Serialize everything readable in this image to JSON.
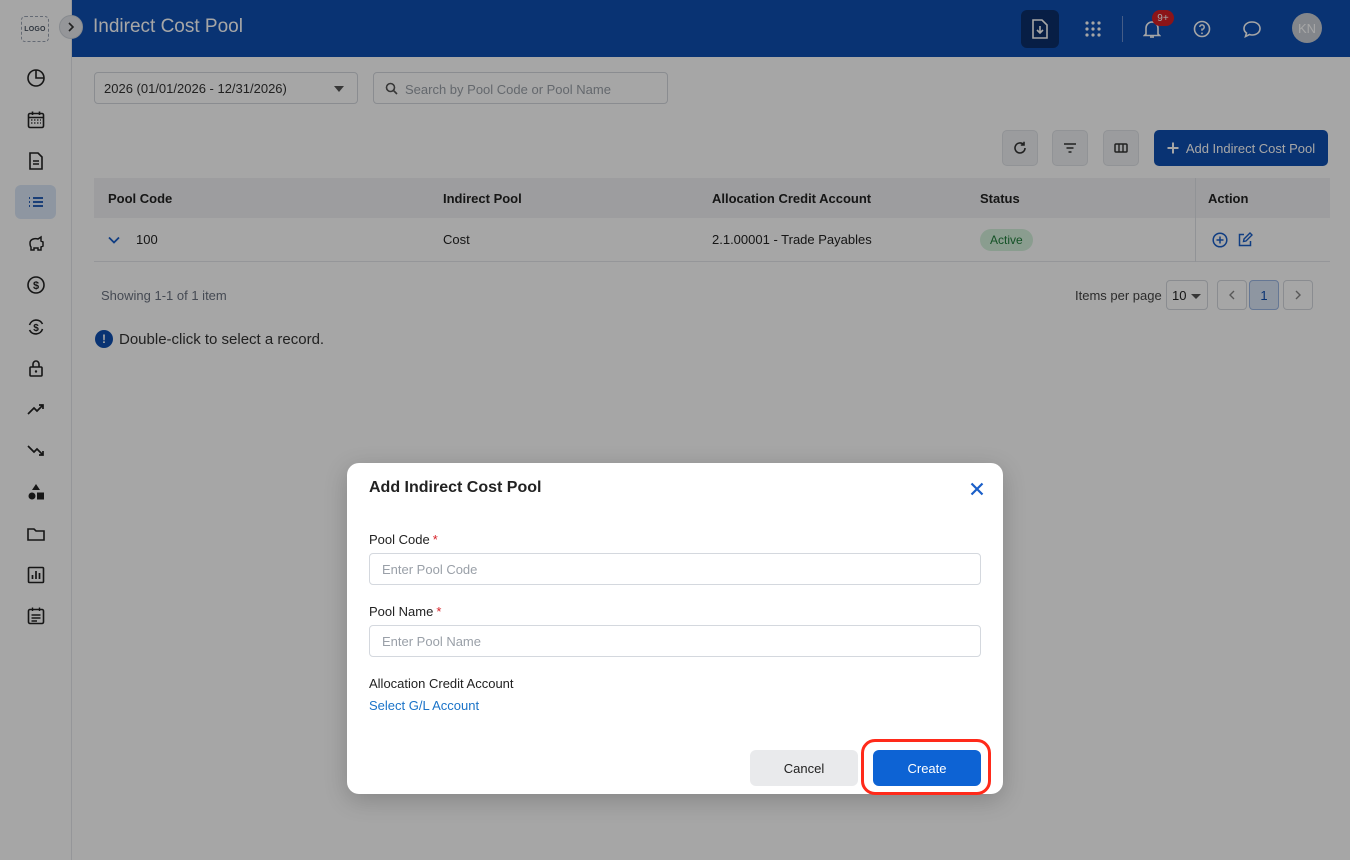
{
  "app": {
    "logo_text": "LOGO",
    "title": "Indirect Cost Pool"
  },
  "header": {
    "notifications_badge": "9+",
    "avatar_initials": "KN"
  },
  "sidebar": {
    "items": [
      {
        "icon": "dashboard-icon"
      },
      {
        "icon": "calendar-icon"
      },
      {
        "icon": "document-icon"
      },
      {
        "icon": "list-icon",
        "active": true
      },
      {
        "icon": "piggy-bank-icon"
      },
      {
        "icon": "dollar-icon"
      },
      {
        "icon": "dollar-exchange-icon"
      },
      {
        "icon": "lock-icon"
      },
      {
        "icon": "trend-up-icon"
      },
      {
        "icon": "trend-down-icon"
      },
      {
        "icon": "shapes-icon"
      },
      {
        "icon": "folder-icon"
      },
      {
        "icon": "bar-chart-icon"
      },
      {
        "icon": "schedule-icon"
      }
    ]
  },
  "filters": {
    "year": "2026 (01/01/2026 - 12/31/2026)",
    "search_placeholder": "Search by Pool Code or Pool Name"
  },
  "toolbar": {
    "add_label": "Add Indirect Cost Pool"
  },
  "table": {
    "columns": [
      "Pool Code",
      "Indirect Pool",
      "Allocation Credit Account",
      "Status",
      "Action"
    ],
    "rows": [
      {
        "pool_code": "100",
        "indirect_pool": "Cost",
        "account": "2.1.00001 - Trade Payables",
        "status": "Active"
      }
    ]
  },
  "pagination": {
    "showing": "Showing 1-1 of 1 item",
    "items_per_page_label": "Items per page",
    "items_per_page": "10",
    "current_page": "1"
  },
  "hint": "Double-click to select a record.",
  "modal": {
    "title": "Add Indirect Cost Pool",
    "pool_code_label": "Pool Code",
    "pool_code_placeholder": "Enter Pool Code",
    "pool_name_label": "Pool Name",
    "pool_name_placeholder": "Enter Pool Name",
    "required_mark": "*",
    "account_label": "Allocation Credit Account",
    "account_link": "Select G/L Account",
    "cancel_label": "Cancel",
    "create_label": "Create"
  },
  "colors": {
    "brand": "#0f4fb1",
    "primary_button": "#0d63d4",
    "highlight": "#ff2a1a",
    "status_active": "#1e7d3a"
  }
}
